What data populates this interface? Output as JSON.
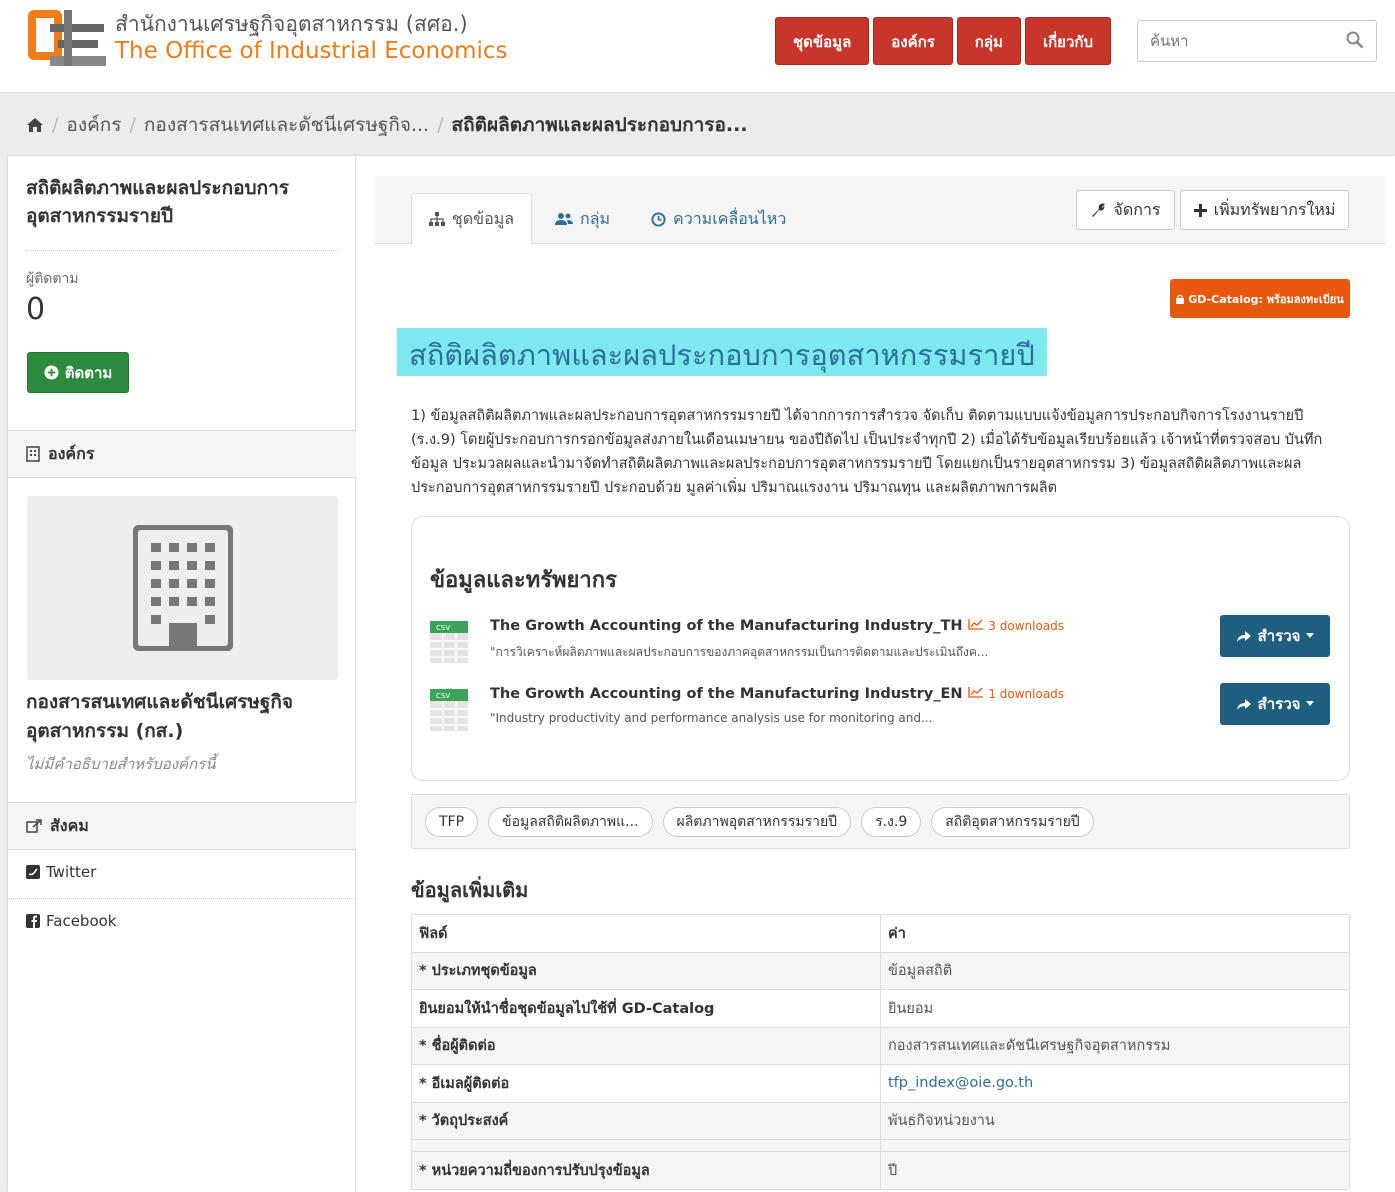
{
  "header": {
    "brand_th": "สำนักงานเศรษฐกิจอุตสาหกรรม (สศอ.)",
    "brand_en": "The Office of Industrial Economics",
    "nav": [
      "ชุดข้อมูล",
      "องค์กร",
      "กลุ่ม",
      "เกี่ยวกับ"
    ],
    "search_placeholder": "ค้นหา",
    "nav_color": "#c8362b",
    "brand_color": "#f07c18"
  },
  "breadcrumb": {
    "home_icon": "home-icon",
    "items": [
      "องค์กร",
      "กองสารสนเทศและดัชนีเศรษฐกิจ...",
      "สถิติผลิตภาพและผลประกอบการอ..."
    ]
  },
  "sidebar": {
    "title": "สถิติผลิตภาพและผลประกอบการอุตสาหกรรมรายปี",
    "followers_label": "ผู้ติดตาม",
    "followers_count": "0",
    "follow_button": "ติดตาม",
    "org_section": "องค์กร",
    "org_name": "กองสารสนเทศและดัชนีเศรษฐกิจอุตสาหกรรม (กส.)",
    "org_desc": "ไม่มีคำอธิบายสำหรับองค์กรนี้",
    "social_section": "สังคม",
    "social": [
      "Twitter",
      "Facebook"
    ]
  },
  "tabs": [
    "ชุดข้อมูล",
    "กลุ่ม",
    "ความเคลื่อนไหว"
  ],
  "actions": {
    "manage": "จัดการ",
    "add_resource": "เพิ่มทรัพยากรใหม่"
  },
  "badge": "GD-Catalog: พร้อมลงทะเบียน",
  "dataset": {
    "title": "สถิติผลิตภาพและผลประกอบการอุตสาหกรรมรายปี",
    "description": "1) ข้อมูลสถิติผลิตภาพและผลประกอบการอุตสาหกรรมรายปี ได้จากการการสำรวจ จัดเก็บ ติดตามแบบแจ้งข้อมูลการประกอบกิจการโรงงานรายปี (ร.ง.9) โดยผู้ประกอบการกรอกข้อมูลส่งภายในเดือนเมษายน ของปีถัดไป เป็นประจำทุกปี 2) เมื่อได้รับข้อมูลเรียบร้อยแล้ว เจ้าหน้าที่ตรวจสอบ บันทึกข้อมูล ประมวลผลและนำมาจัดทำสถิติผลิตภาพและผลประกอบการอุตสาหกรรมรายปี โดยแยกเป็นรายอุตสาหกรรม 3) ข้อมูลสถิติผลิตภาพและผลประกอบการอุตสาหกรรมรายปี ประกอบด้วย มูลค่าเพิ่ม ปริมาณแรงงาน ปริมาณทุน และผลิตภาพการผลิต"
  },
  "resources": {
    "heading": "ข้อมูลและทรัพยากร",
    "explore_label": "สำรวจ",
    "items": [
      {
        "format": "CSV",
        "name": "The Growth Accounting of the Manufacturing Industry_TH",
        "downloads": "3 downloads",
        "desc": "\"การวิเคราะห์ผลิตภาพและผลประกอบการของภาคอุตสาหกรรมเป็นการติดตามและประเมินถึงค..."
      },
      {
        "format": "CSV",
        "name": "The Growth Accounting of the Manufacturing Industry_EN",
        "downloads": "1 downloads",
        "desc": "\"Industry productivity and performance analysis use for monitoring and..."
      }
    ]
  },
  "tags": [
    "TFP",
    "ข้อมูลสถิติผลิตภาพแ...",
    "ผลิตภาพอุตสาหกรรมรายปี",
    "ร.ง.9",
    "สถิติอุตสาหกรรมรายปี"
  ],
  "additional": {
    "heading": "ข้อมูลเพิ่มเติม",
    "header_field": "ฟิลด์",
    "header_value": "ค่า",
    "rows": [
      {
        "field": "* ประเภทชุดข้อมูล",
        "value": "ข้อมูลสถิติ"
      },
      {
        "field": "ยินยอมให้นำชื่อชุดข้อมูลไปใช้ที่ GD-Catalog",
        "value": "ยินยอม"
      },
      {
        "field": "* ชื่อผู้ติดต่อ",
        "value": "กองสารสนเทศและดัชนีเศรษฐกิจอุตสาหกรรม"
      },
      {
        "field": "* อีเมลผู้ติดต่อ",
        "value": "tfp_index@oie.go.th"
      },
      {
        "field": "* วัตถุประสงค์",
        "value": "พันธกิจหน่วยงาน"
      },
      {
        "field": "* หน่วยความถี่ของการปรับปรุงข้อมูล",
        "value": "ปี"
      }
    ]
  }
}
